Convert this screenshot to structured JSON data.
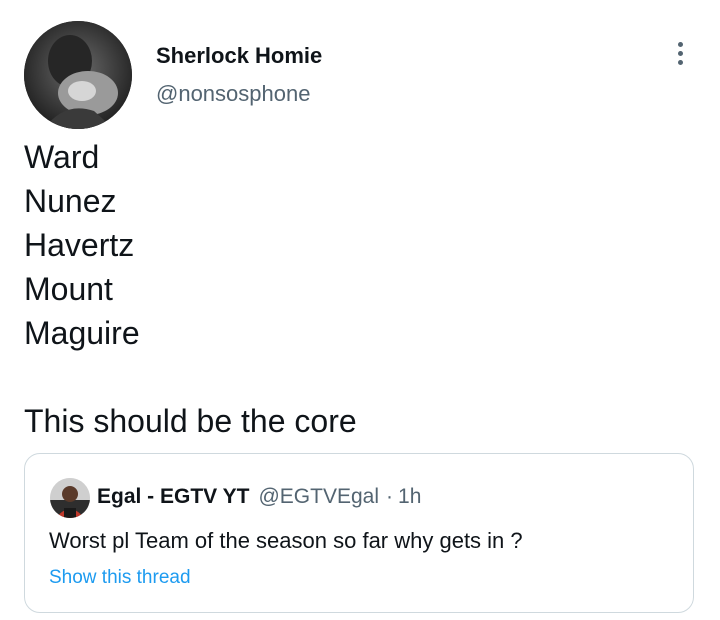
{
  "author": {
    "name": "Sherlock Homie",
    "handle": "@nonsosphone",
    "avatar_icon": "profile-photo"
  },
  "more_icon": "three-dots-vertical-icon",
  "tweet": {
    "lines": [
      "Ward",
      "Nunez",
      "Havertz",
      "Mount",
      "Maguire"
    ],
    "closing": "This should be the core"
  },
  "quoted_tweet": {
    "name": "Egal - EGTV YT",
    "handle": "@EGTVEgal",
    "separator": "·",
    "time": "1h",
    "text": "Worst pl Team of the season so far why gets in ?",
    "link": "Show this thread"
  },
  "colors": {
    "text": "#0f1419",
    "secondary": "#536471",
    "link": "#1d9bf0",
    "border": "#cfd9de"
  }
}
